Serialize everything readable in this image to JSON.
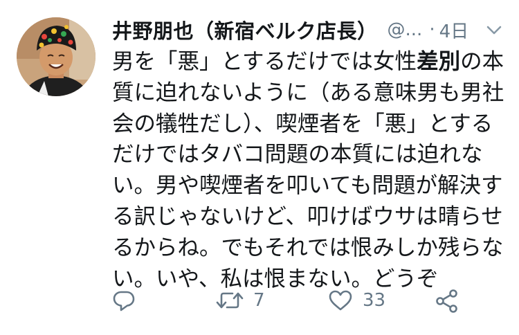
{
  "user": {
    "display_name": "井野朋也（新宿ベルク店長）",
    "handle": "@...",
    "separator": "·",
    "time": "4日"
  },
  "tweet": {
    "lines": [
      [
        "男を「悪」とするだけでは女性",
        "差別",
        "の本"
      ],
      [
        "質に迫れないように（ある意味男も男社"
      ],
      [
        "会の犠牲だし）、喫煙者を「悪」とする"
      ],
      [
        "だけではタバコ問題の本質には迫れな"
      ],
      [
        "い。男や喫煙者を叩いても問題が解決す"
      ],
      [
        "る訳じゃないけど、叩けばウサは晴らせ"
      ],
      [
        "るからね。でもそれでは恨みしか残らな"
      ],
      [
        "い。いや、私は恨まない。どうぞ"
      ]
    ]
  },
  "actions": {
    "reply_icon": "reply-icon",
    "retweet_icon": "retweet-icon",
    "retweet_count": "7",
    "like_icon": "heart-icon",
    "like_count": "33",
    "share_icon": "share-icon"
  },
  "colors": {
    "text": "#14171a",
    "secondary": "#657786"
  }
}
